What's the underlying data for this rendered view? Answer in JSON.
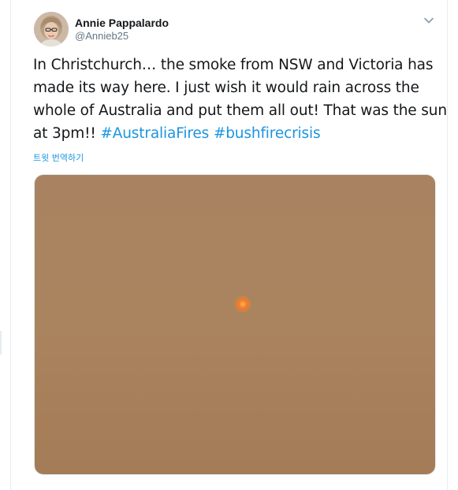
{
  "tweet": {
    "author_name": "Annie Pappalardo",
    "author_handle": "@Annieb25",
    "text_main": "In Christchurch… the smoke from NSW and Victoria has made its way here. I just wish it would rain across the whole of Australia and put them all out! That was the sun at 3pm!! ",
    "hashtags": [
      "#AustraliaFires",
      "#bushfirecrisis"
    ],
    "translate_link": "트윗 번역하기",
    "menu_icon": "chevron-down-icon",
    "media_alt": "photo"
  },
  "colors": {
    "link": "#1b95e0",
    "text": "#14171a",
    "muted": "#657786",
    "sky": "#a9825f",
    "sun": "#f07a2a"
  }
}
